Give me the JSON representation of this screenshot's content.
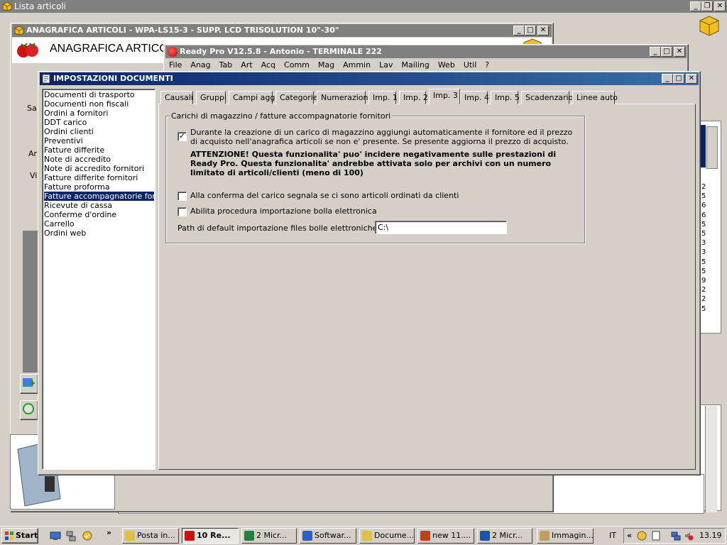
{
  "desktop_window": {
    "title": "Lista articoli"
  },
  "anagrafica_window": {
    "title": "ANAGRAFICA ARTICOLI - WPA-LS15-3 - SUPP. LCD TRISOLUTION 10\"-30\"",
    "header": "ANAGRAFICA ARTICOLI",
    "side_labels": [
      "Sa",
      "Ar",
      "Vi"
    ]
  },
  "readypro_window": {
    "title": "Ready Pro V12.5.8 - Antonio - TERMINALE 222",
    "menu": [
      "File",
      "Anag",
      "Tab",
      "Art",
      "Acq",
      "Comm",
      "Mag",
      "Ammin",
      "Lav",
      "Mailing",
      "Web",
      "Util",
      "?"
    ]
  },
  "settings_window": {
    "title": "IMPOSTAZIONI DOCUMENTI",
    "documents": [
      "Documenti di trasporto",
      "Documenti non fiscali",
      "Ordini a fornitori",
      "DDT carico",
      "Ordini clienti",
      "Preventivi",
      "Fatture differite",
      "Note di accredito",
      "Note di accredito fornitori",
      "Fatture differite fornitori",
      "Fatture proforma",
      "Fatture accompagnatorie fornitori",
      "Ricevute di cassa",
      "Conferme d'ordine",
      "Carrello",
      "Ordini web"
    ],
    "selected_document_index": 11,
    "tabs": [
      "Causali",
      "Gruppi",
      "Campi agg.",
      "Categorie",
      "Numerazioni",
      "Imp. 1",
      "Imp. 2",
      "Imp. 3",
      "Imp. 4",
      "Imp. 5",
      "Scadenzario",
      "Linee auto"
    ],
    "active_tab_index": 7,
    "group_title": "Carichi di magazzino / fatture accompagnatorie fornitori",
    "option1": {
      "line1": "Durante la creazione di un carico di magazzino aggiungi automaticamente il fornitore ed il prezzo",
      "line2": "di acquisto nell'anagrafica articoli se non e' presente. Se presente aggiorna il prezzo di acquisto.",
      "checked": true
    },
    "warning": {
      "line1": "ATTENZIONE! Questa funzionalita' puo' incidere negativamente sulle prestazioni di",
      "line2": "Ready Pro. Questa funzionalita' andrebbe attivata solo per archivi con un numero",
      "line3": "limitato di articoli/clienti (meno di 100)"
    },
    "option2": {
      "label": "Alla conferma del carico segnala se ci sono articoli ordinati da clienti",
      "checked": false
    },
    "option3": {
      "label": "Abilita procedura importazione bolla elettronica",
      "checked": false
    },
    "path": {
      "label": "Path di default importazione files bolle elettroniche fornitori",
      "value": "C:\\"
    }
  },
  "bg_right_digits": [
    "2",
    "5",
    "6",
    "6",
    "5",
    "5",
    "3",
    "3",
    "5",
    "5",
    "9",
    "2",
    "2",
    "5"
  ],
  "taskbar": {
    "start": "Start",
    "tasks": [
      "Posta in...",
      "10 Re...",
      "2 Micr...",
      "Softwar...",
      "Docume...",
      "new 11....",
      "2 Micr...",
      "Immagin..."
    ],
    "language": "IT",
    "clock": "13.19",
    "chevron": "»",
    "tray_chevron": "«"
  },
  "icons": {
    "window_buttons": [
      "minimize-icon",
      "maximize-icon",
      "close-icon"
    ],
    "box_icon": "yellow-box-icon",
    "strawberry_icon": "strawberry-icon",
    "checkmark": "✓"
  },
  "colors": {
    "active_title": "#0a246a",
    "inactive_title": "#808080",
    "selection": "#0a246a",
    "face": "#d4d0c8"
  }
}
